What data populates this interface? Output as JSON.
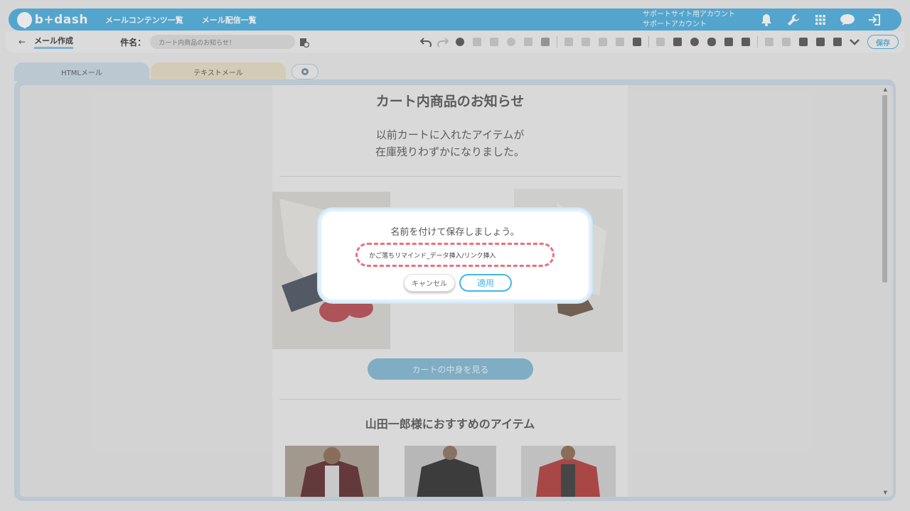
{
  "header": {
    "logo_text": "b+dash",
    "nav": [
      "メールコンテンツ一覧",
      "メール配信一覧"
    ],
    "account_lines": [
      "サポートサイト用アカウント",
      "サポートアカウント"
    ],
    "icons": [
      "bell-icon",
      "wrench-icon",
      "grid-icon",
      "chat-icon",
      "logout-icon"
    ]
  },
  "subbar": {
    "back_glyph": "←",
    "page_title": "メール作成",
    "subject_label": "件名：",
    "subject_value": "カート内商品のお知らせ！",
    "save_label": "保存"
  },
  "tabs": {
    "html": "HTMLメール",
    "text": "テキストメール"
  },
  "mail": {
    "title": "カート内商品のお知らせ",
    "lead_1": "以前カートに入れたアイテムが",
    "lead_2": "在庫残りわずかになりました。",
    "cart_button": "カートの中身を見る",
    "recommend_title": "山田一郎様におすすめのアイテム"
  },
  "modal": {
    "title": "名前を付けて保存しましょう。",
    "name_value": "かご落ちリマインド_データ挿入/リンク挿入",
    "cancel_label": "キャンセル",
    "apply_label": "適用"
  },
  "colors": {
    "brand": "#4aaee0",
    "accent_dash": "#ee6f7b",
    "apply": "#45b6e6"
  }
}
